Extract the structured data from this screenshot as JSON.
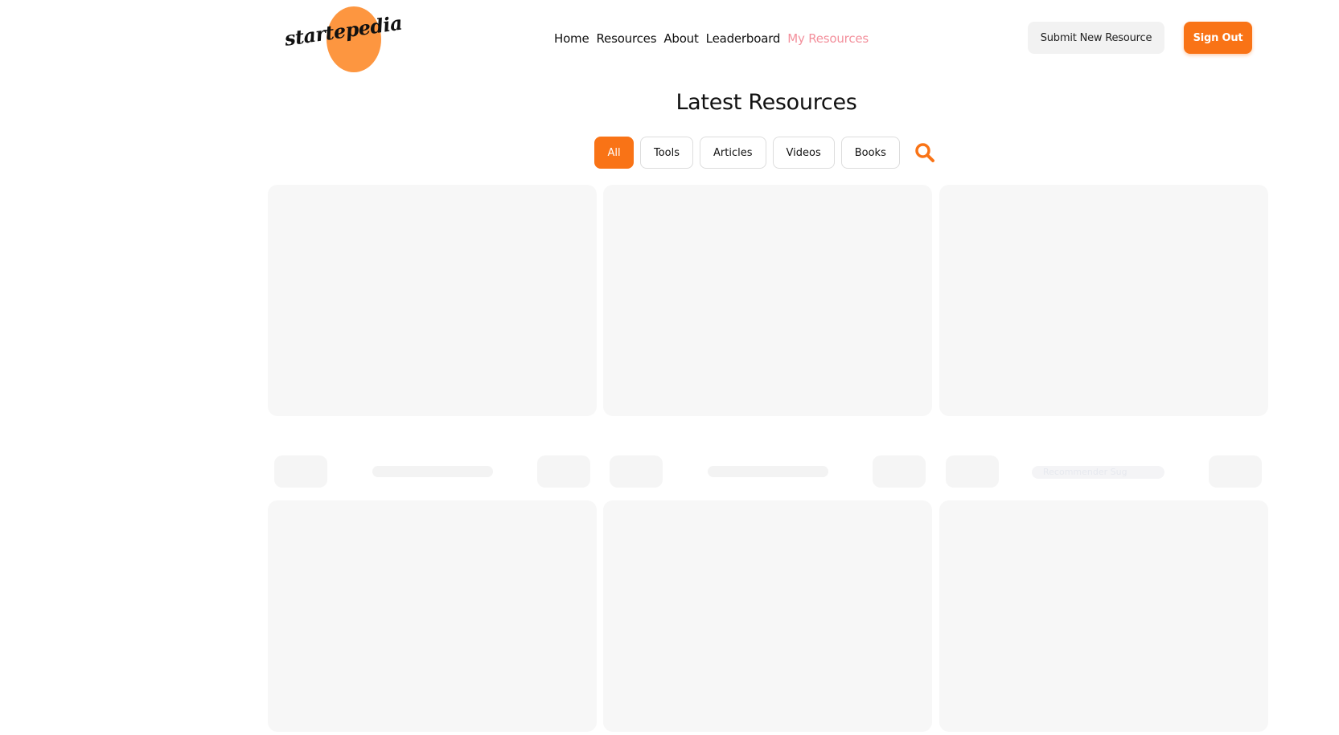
{
  "brand": {
    "logo_text": "startepedia",
    "logo_color": "#fd9640"
  },
  "nav": {
    "items": [
      {
        "label": "Home"
      },
      {
        "label": "Resources"
      },
      {
        "label": "About"
      },
      {
        "label": "Leaderboard"
      },
      {
        "label": "My Resources"
      }
    ],
    "active_label": "My Resources",
    "active_color": "#f3909c"
  },
  "header": {
    "submit_label": "Submit New Resource",
    "signout_label": "Sign Out"
  },
  "main": {
    "title": "Latest Resources",
    "filters": [
      {
        "label": "All"
      },
      {
        "label": "Tools"
      },
      {
        "label": "Articles"
      },
      {
        "label": "Videos"
      },
      {
        "label": "Books"
      }
    ],
    "active_filter": "All",
    "search_icon": "search-icon",
    "cards_loading_hint": "Recommender Sug"
  },
  "colors": {
    "accent": "#f97316",
    "skeleton": "#f7f7f7"
  }
}
